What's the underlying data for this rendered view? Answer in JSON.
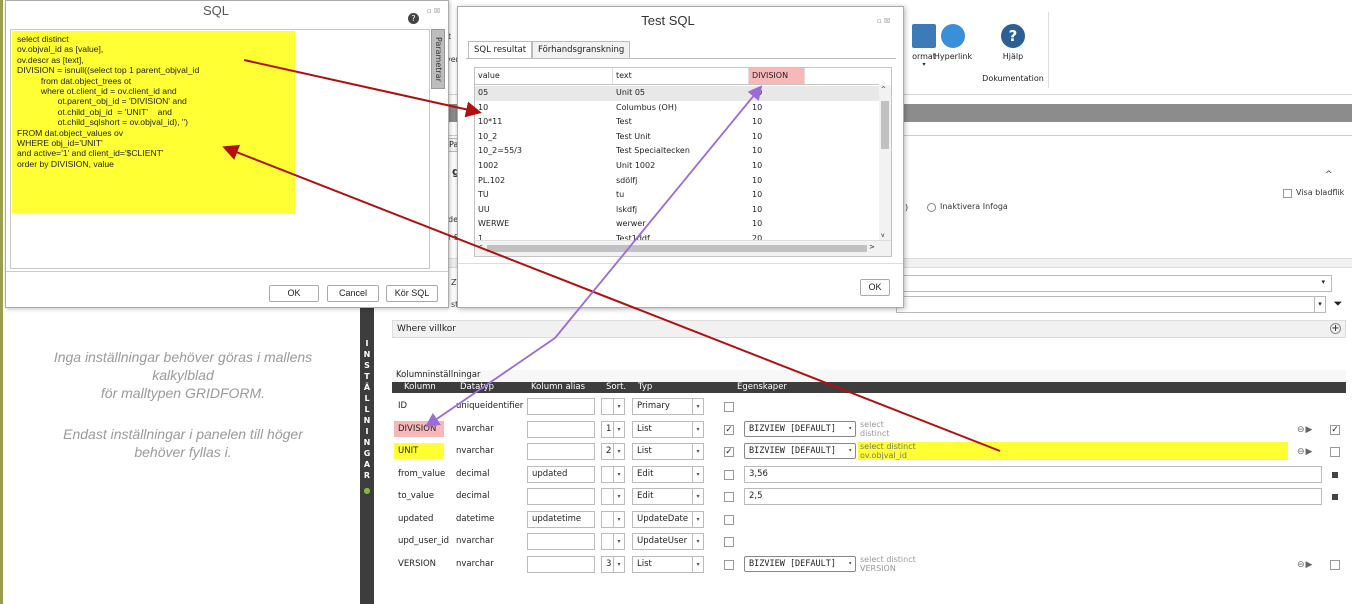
{
  "sql_dialog": {
    "title": "SQL",
    "help_icon": "question-icon",
    "window_buttons": "▫ ☒",
    "param_tab": "Parametrar",
    "code": "select distinct\nov.objval_id as [value],\nov.descr as [text],\nDIVISION = isnull((select top 1 parent_objval_id\n          from dat.object_trees ot\n          where ot.client_id = ov.client_id and\n                 ot.parent_obj_id = 'DIVISION' and\n                 ot.child_obj_id  = 'UNIT'    and\n                 ot.child_sqlshort = ov.objval_id), '')\nFROM dat.object_values ov\nWHERE obj_id='UNIT'\nand active='1' and client_id='$CLIENT'\norder by DIVISION, value",
    "ok": "OK",
    "cancel": "Cancel",
    "run": "Kör SQL"
  },
  "test_dialog": {
    "title": "Test SQL",
    "window_buttons": "▫ ☒",
    "tabs": [
      "SQL resultat",
      "Förhandsgranskning"
    ],
    "columns": [
      "value",
      "text",
      "DIVISION"
    ],
    "rows": [
      [
        "05",
        "Unit 05",
        "10"
      ],
      [
        "10",
        "Columbus (OH)",
        "10"
      ],
      [
        "10*11",
        "Test",
        "10"
      ],
      [
        "10_2",
        "Test Unit",
        "10"
      ],
      [
        "10_2=55/3",
        "Test Specialtecken",
        "10"
      ],
      [
        "1002",
        "Unit 1002",
        "10"
      ],
      [
        "PL.102",
        "sdölfj",
        "10"
      ],
      [
        "TU",
        "tu",
        "10"
      ],
      [
        "UU",
        "lskdfj",
        "10"
      ],
      [
        "WERWE",
        "werwer",
        "10"
      ],
      [
        "1",
        "Test1ddf",
        "20"
      ]
    ],
    "ok": "OK"
  },
  "ribbon": {
    "fragment_t": "t",
    "fragment_ver": "ver",
    "format_label": "ormat",
    "hyperlink_label": "Hyperlink",
    "help_label": "Hjälp",
    "group_label": "Dokumentation"
  },
  "mid": {
    "frag_pa": "Pa",
    "frag_g": "g",
    "frag_der": "der",
    "frag_rs": "r S",
    "frag_paren": ")",
    "inaktivera": "Inaktivera Infoga",
    "visa": "Visa bladflik",
    "frag_zv": "ZV",
    "frag_st": "st.",
    "caret": "^"
  },
  "left_info": {
    "line1": "Inga inställningar behöver göras i mallens",
    "line2": "kalkylblad",
    "line3": "för malltypen GRIDFORM.",
    "line4": "Endast inställningar i panelen till höger",
    "line5": "behöver fyllas i."
  },
  "vertical_tab": [
    "I",
    "N",
    "S",
    "T",
    "Ä",
    "L",
    "L",
    "N",
    "I",
    "N",
    "G",
    "A",
    "R"
  ],
  "grid": {
    "where_label": "Where villkor",
    "kolumn_label": "Kolumninställningar",
    "headers": {
      "kolumn": "Kolumn",
      "datatyp": "Datatyp",
      "alias": "Kolumn alias",
      "sort": "Sort.",
      "typ": "Typ",
      "egenskaper": "Egenskaper"
    },
    "rows": [
      {
        "kolumn": "ID",
        "datatyp": "uniqueidentifier",
        "alias": "",
        "sort": "",
        "typ": "Primary",
        "checked": false
      },
      {
        "kolumn": "DIVISION",
        "datatyp": "nvarchar",
        "alias": "",
        "sort": "1",
        "typ": "List",
        "checked": true,
        "biz": "BIZVIEW [DEFAULT]",
        "sql": "select\ndistinct"
      },
      {
        "kolumn": "UNIT",
        "datatyp": "nvarchar",
        "alias": "",
        "sort": "2",
        "typ": "List",
        "checked": true,
        "biz": "BIZVIEW [DEFAULT]",
        "sql": "select distinct\nov.objval_id"
      },
      {
        "kolumn": "from_value",
        "datatyp": "decimal",
        "alias": "updated",
        "sort": "",
        "typ": "Edit",
        "checked": false,
        "value": "3,56"
      },
      {
        "kolumn": "to_value",
        "datatyp": "decimal",
        "alias": "",
        "sort": "",
        "typ": "Edit",
        "checked": false,
        "value": "2,5"
      },
      {
        "kolumn": "updated",
        "datatyp": "datetime",
        "alias": "updatetime",
        "sort": "",
        "typ": "UpdateDate",
        "checked": false
      },
      {
        "kolumn": "upd_user_id",
        "datatyp": "nvarchar",
        "alias": "",
        "sort": "",
        "typ": "UpdateUser",
        "checked": false
      },
      {
        "kolumn": "VERSION",
        "datatyp": "nvarchar",
        "alias": "",
        "sort": "3",
        "typ": "List",
        "checked": false,
        "biz": "BIZVIEW [DEFAULT]",
        "sql": "select distinct\nVERSION"
      }
    ]
  },
  "colors": {
    "highlight_yellow": "#ffff33",
    "highlight_pink": "#f8b8b8",
    "arrow_red": "#b01010",
    "arrow_purple": "#9b6bd8",
    "dark_band": "#3d3d3d"
  }
}
